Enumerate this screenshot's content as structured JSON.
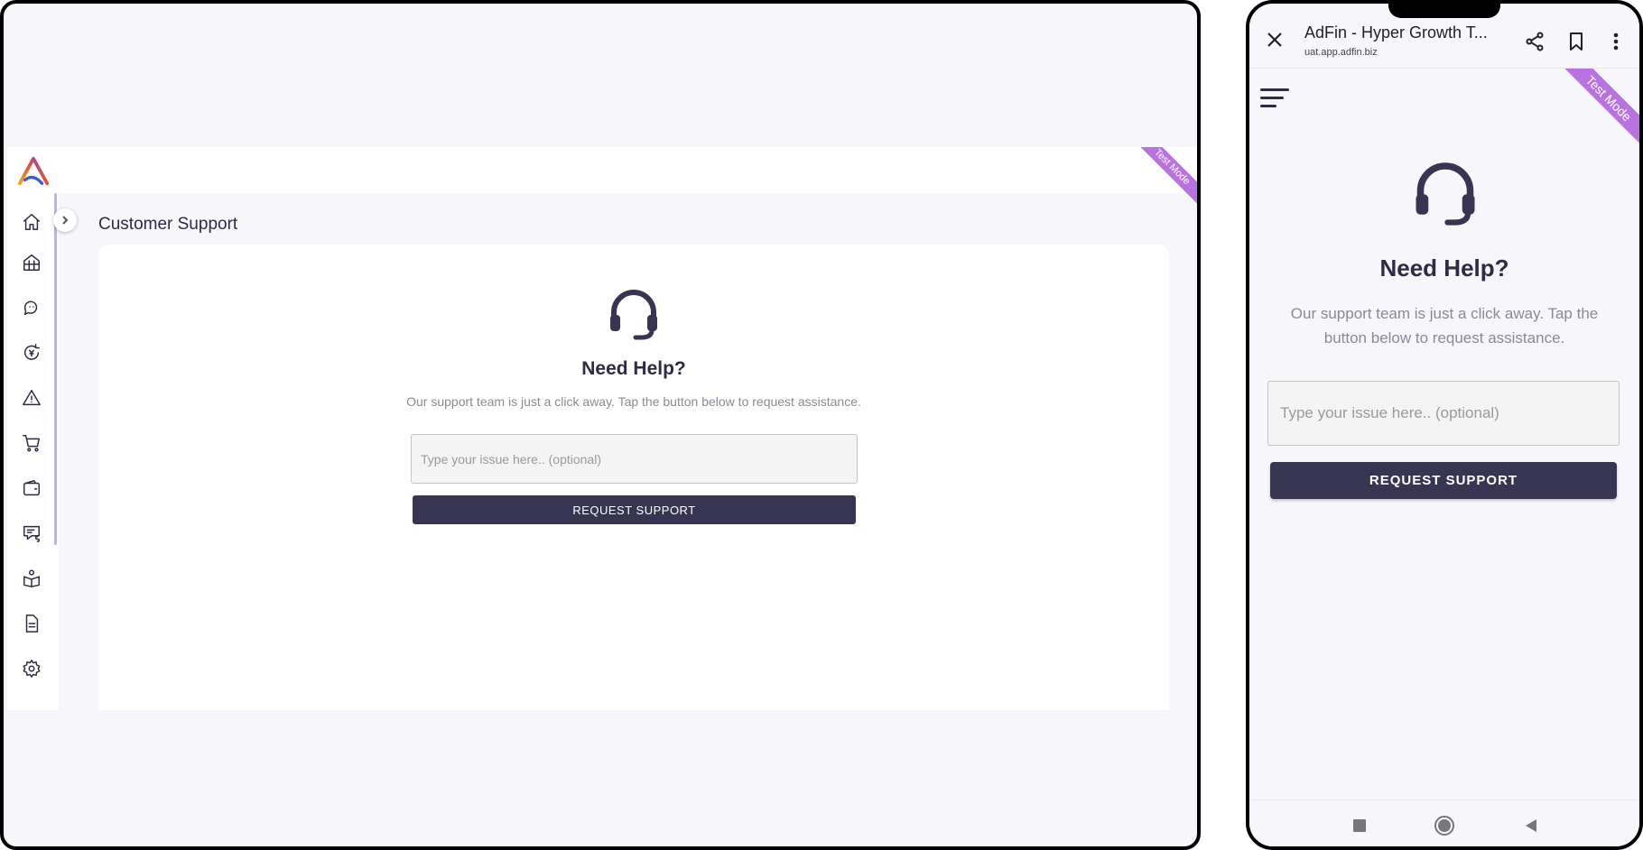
{
  "tablet": {
    "sidebar": {
      "items": [
        {
          "name": "home",
          "icon": "home-icon"
        },
        {
          "name": "marketplace",
          "icon": "greenhouse-icon"
        },
        {
          "name": "chat",
          "icon": "chat-icon"
        },
        {
          "name": "payments",
          "icon": "cycle-money-icon"
        },
        {
          "name": "alerts",
          "icon": "warning-icon"
        },
        {
          "name": "orders",
          "icon": "cart-icon"
        },
        {
          "name": "wallet",
          "icon": "wallet-icon"
        },
        {
          "name": "billing",
          "icon": "message-dollar-icon"
        },
        {
          "name": "learn",
          "icon": "book-person-icon"
        },
        {
          "name": "documents",
          "icon": "document-icon"
        },
        {
          "name": "settings",
          "icon": "gear-icon"
        }
      ]
    },
    "ribbon": "Test Mode",
    "page_title": "Customer Support",
    "support": {
      "heading": "Need Help?",
      "description": "Our support team is just a click away. Tap the button below to request assistance.",
      "input_placeholder": "Type your issue here.. (optional)",
      "button_label": "REQUEST SUPPORT"
    }
  },
  "phone": {
    "browser": {
      "title": "AdFin - Hyper Growth T...",
      "url": "uat.app.adfin.biz"
    },
    "ribbon": "Test Mode",
    "support": {
      "heading": "Need Help?",
      "description": "Our support team is just a click away. Tap the button below to request assistance.",
      "input_placeholder": "Type your issue here.. (optional)",
      "button_label": "REQUEST SUPPORT"
    }
  },
  "colors": {
    "primary": "#373552",
    "ribbon": "#b873e0",
    "background": "#f6f6fb",
    "muted_text": "#8a8a96"
  }
}
